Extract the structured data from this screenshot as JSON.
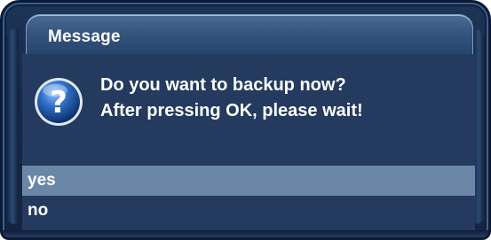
{
  "dialog": {
    "title": "Message",
    "icon": "question-icon",
    "message_lines": [
      "Do you want to backup now?",
      "After pressing OK, please wait!"
    ],
    "options": [
      {
        "label": "yes",
        "selected": true
      },
      {
        "label": "no",
        "selected": false
      }
    ]
  },
  "colors": {
    "background": "#1d3557",
    "titlebar": "#35557e",
    "selection": "#6b87a8",
    "text": "#ffffff",
    "icon_blue": "#2f6fc4"
  }
}
